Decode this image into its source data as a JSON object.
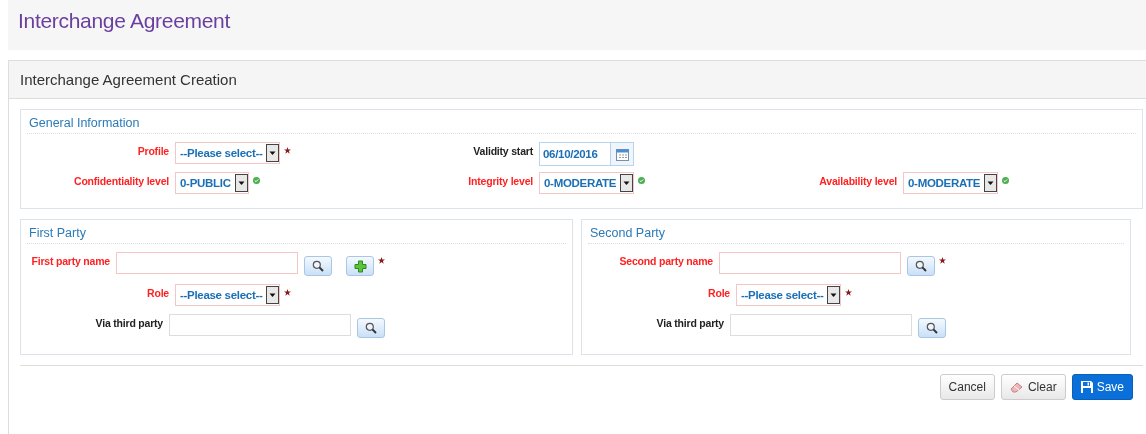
{
  "page_title": "Interchange Agreement",
  "panel": {
    "title": "Interchange Agreement Creation"
  },
  "general": {
    "title": "General Information",
    "rows": [
      [
        {
          "label": "Profile",
          "kind": "select",
          "value": "--Please select--",
          "required": true,
          "valid": false
        },
        {
          "label": "Validity start",
          "kind": "date",
          "value": "06/10/2016",
          "required": false,
          "valid": false
        }
      ],
      [
        {
          "label": "Confidentiality level",
          "kind": "select",
          "value": "0-PUBLIC",
          "required": true,
          "valid": true
        },
        {
          "label": "Integrity level",
          "kind": "select",
          "value": "0-MODERATE",
          "required": true,
          "valid": true
        },
        {
          "label": "Availability level",
          "kind": "select",
          "value": "0-MODERATE",
          "required": true,
          "valid": true
        }
      ]
    ]
  },
  "parties": [
    {
      "title": "First Party",
      "fields": [
        {
          "label": "First party name",
          "kind": "text",
          "required": true,
          "lookup": true,
          "add": true
        },
        {
          "label": "Role",
          "kind": "select",
          "value": "--Please select--",
          "required": true,
          "lookup": false,
          "add": false
        },
        {
          "label": "Via third party",
          "kind": "text",
          "required": false,
          "lookup": true,
          "add": false
        }
      ]
    },
    {
      "title": "Second Party",
      "fields": [
        {
          "label": "Second party name",
          "kind": "text",
          "required": true,
          "lookup": true,
          "add": false
        },
        {
          "label": "Role",
          "kind": "select",
          "value": "--Please select--",
          "required": true,
          "lookup": false,
          "add": false
        },
        {
          "label": "Via third party",
          "kind": "text",
          "required": false,
          "lookup": true,
          "add": false
        }
      ]
    }
  ],
  "buttons": [
    {
      "label": "Cancel",
      "kind": "plain"
    },
    {
      "label": "Clear",
      "kind": "clear"
    },
    {
      "label": "Save",
      "kind": "primary"
    }
  ]
}
